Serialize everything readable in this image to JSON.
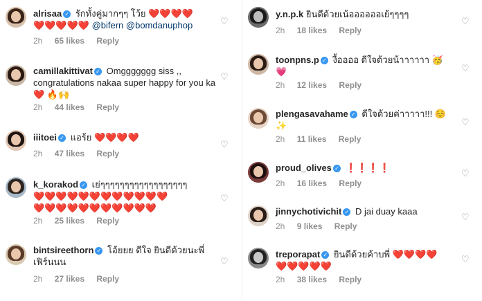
{
  "left": [
    {
      "user": "alrisaa",
      "verified": true,
      "text": "รักทั้งคู่มากๆๆ โว้ย",
      "hearts1": "❤️❤️❤️❤️",
      "hearts2": "❤️❤️❤️❤️❤️",
      "mention": "@bifern @bomdanuphop",
      "time": "2h",
      "likes": "65 likes",
      "reply": "Reply"
    },
    {
      "user": "camillakittivat",
      "verified": true,
      "text": "Omggggggg siss ,, congratulations nakaa super happy for you ka",
      "extra": "❤️ 🔥🙌",
      "time": "2h",
      "likes": "44 likes",
      "reply": "Reply"
    },
    {
      "user": "iiitoei",
      "verified": true,
      "text": "แอร้ย",
      "hearts1": "❤️❤️❤️❤️",
      "time": "2h",
      "likes": "47 likes",
      "reply": "Reply"
    },
    {
      "user": "k_korakod",
      "verified": true,
      "text": "เย่ๆๆๆๆๆๆๆๆๆๆๆๆๆๆๆๆๆๆ",
      "hearts1": "❤️❤️❤️❤️❤️❤️❤️❤️❤️❤️❤️❤️",
      "hearts2": "❤️❤️❤️❤️❤️❤️❤️❤️❤️❤️❤️",
      "time": "2h",
      "likes": "25 likes",
      "reply": "Reply"
    },
    {
      "user": "bintsireethorn",
      "verified": true,
      "text": "โอ้ยยย ดีใจ ยินดีด้วยนะพี่เฟิร์นนน",
      "time": "2h",
      "likes": "27 likes",
      "reply": "Reply"
    }
  ],
  "right": [
    {
      "user": "y.n.p.k",
      "verified": false,
      "text": "ยินดีด้วยเน้ออออออเย้ๆๆๆๆ",
      "time": "2h",
      "likes": "18 likes",
      "reply": "Reply"
    },
    {
      "user": "toonpns.p",
      "verified": true,
      "text": "งื้ออออ ดีใจด้วยน้าาาาาา 🥳",
      "extra": "💗",
      "time": "2h",
      "likes": "12 likes",
      "reply": "Reply"
    },
    {
      "user": "plengasavahame",
      "verified": true,
      "text": "ดีใจด้วยค่าาาาา!!! ☺️",
      "extra": "✨",
      "time": "2h",
      "likes": "11 likes",
      "reply": "Reply"
    },
    {
      "user": "proud_olives",
      "verified": true,
      "text": "❗❗❗❗",
      "time": "2h",
      "likes": "16 likes",
      "reply": "Reply"
    },
    {
      "user": "jinnychotivichit",
      "verified": true,
      "text": "D jai duay kaaa",
      "time": "2h",
      "likes": "9 likes",
      "reply": "Reply"
    },
    {
      "user": "treporapat",
      "verified": true,
      "text": "ยินดีด้วยค้าบพี่",
      "hearts1": "❤️❤️❤️❤️",
      "hearts2": "❤️❤️❤️❤️❤️",
      "time": "2h",
      "likes": "38 likes",
      "reply": "Reply"
    }
  ],
  "colors": {
    "link": "#00376b",
    "meta": "#8e8e8e",
    "verified": "#3897f0",
    "heart": "#ed4956"
  },
  "icons": {
    "like": "heart-outline-icon",
    "verified": "verified-badge-icon"
  }
}
